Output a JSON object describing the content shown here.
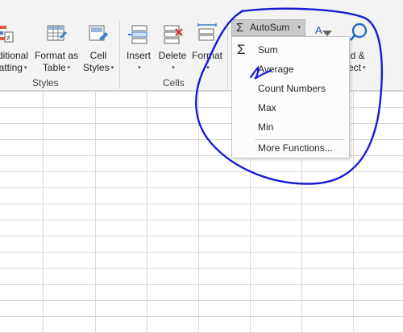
{
  "ribbon": {
    "conditional_formatting": {
      "line1": "ditional",
      "line2": "atting"
    },
    "format_as_table": {
      "line1": "Format as",
      "line2": "Table"
    },
    "cell_styles": {
      "line1": "Cell",
      "line2": "Styles"
    },
    "insert": {
      "label": "Insert"
    },
    "delete": {
      "label": "Delete"
    },
    "format": {
      "label": "Format"
    },
    "find_select": {
      "line1": "nd &",
      "line2": "ect"
    },
    "groups": {
      "styles": "Styles",
      "cells": "Cells"
    }
  },
  "autosum": {
    "label": "AutoSum",
    "symbol": "Σ",
    "caret": "▾"
  },
  "menu": {
    "items": [
      {
        "label": "Sum",
        "icon": "sigma-icon"
      },
      {
        "label": "Average",
        "icon": "checkmark-annotation"
      },
      {
        "label": "Count Numbers"
      },
      {
        "label": "Max"
      },
      {
        "label": "Min"
      },
      {
        "label": "More Functions..."
      }
    ]
  },
  "colors": {
    "annotation_ink": "#1a1ad6",
    "ribbon_bg": "#f3f3f3",
    "grid_line": "#d9d9d9"
  }
}
